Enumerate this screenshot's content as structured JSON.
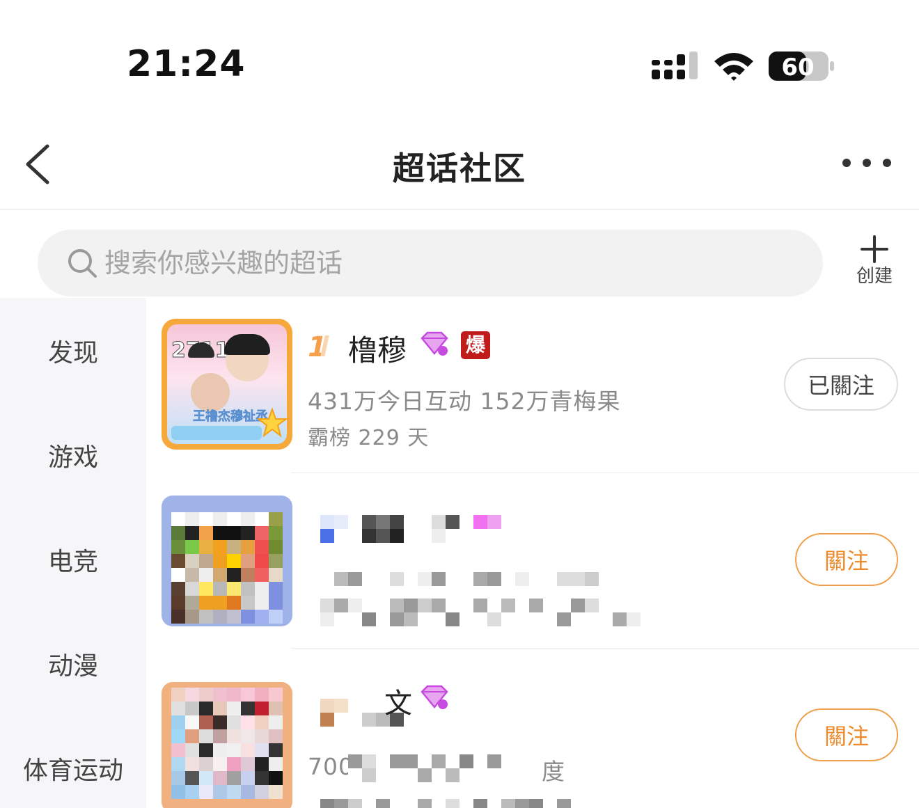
{
  "status": {
    "time": "21:24",
    "battery": "60"
  },
  "nav": {
    "title": "超话社区"
  },
  "search": {
    "placeholder": "搜索你感兴趣的超话"
  },
  "create": {
    "label": "创建"
  },
  "sidebar": {
    "items": [
      {
        "label": "发现"
      },
      {
        "label": "游戏"
      },
      {
        "label": "电竞"
      },
      {
        "label": "动漫"
      },
      {
        "label": "体育运动"
      }
    ]
  },
  "communities": [
    {
      "rank": "1",
      "name": "橹穆",
      "hot_badge": "爆",
      "stats": "431万今日互动 152万青梅果",
      "streak": "霸榜 229 天",
      "button": "已關注",
      "thumb_text": "2711",
      "thumb_caption": "王橹杰穆祉丞"
    },
    {
      "button": "關注"
    },
    {
      "name_fragment": "文",
      "stats_fragment_a": "700",
      "stats_fragment_b": "度",
      "button": "關注"
    }
  ],
  "colors": {
    "accent": "#ef8a2a",
    "hot_badge": "#c01c1c",
    "gem": "#c64be0"
  }
}
